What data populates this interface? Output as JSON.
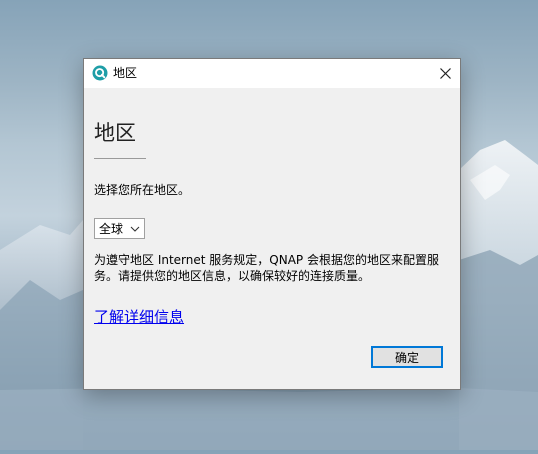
{
  "window": {
    "title": "地区",
    "app_icon": "qnap-q-icon",
    "close_icon": "close-icon"
  },
  "content": {
    "heading": "地区",
    "subtitle": "选择您所在地区。",
    "region_select": {
      "selected": "全球"
    },
    "description": "为遵守地区 Internet 服务规定，QNAP 会根据您的地区来配置服务。请提供您的地区信息，以确保较好的连接质量。",
    "learn_more_link": "了解详细信息",
    "ok_button": "确定"
  },
  "colors": {
    "accent": "#0078d7",
    "link": "#0000ee",
    "app_icon_bg": "#1e9ea7"
  }
}
